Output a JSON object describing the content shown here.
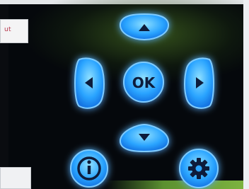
{
  "screen": {
    "text": "ut"
  },
  "keypad": {
    "ok_label": "OK",
    "buttons": [
      "up-arrow",
      "left-arrow",
      "ok",
      "right-arrow",
      "down-arrow",
      "info",
      "settings"
    ],
    "colors": {
      "glow": "#2f8cff",
      "button_fill": "#1b9bff",
      "icon": "#0a1a3a"
    }
  }
}
